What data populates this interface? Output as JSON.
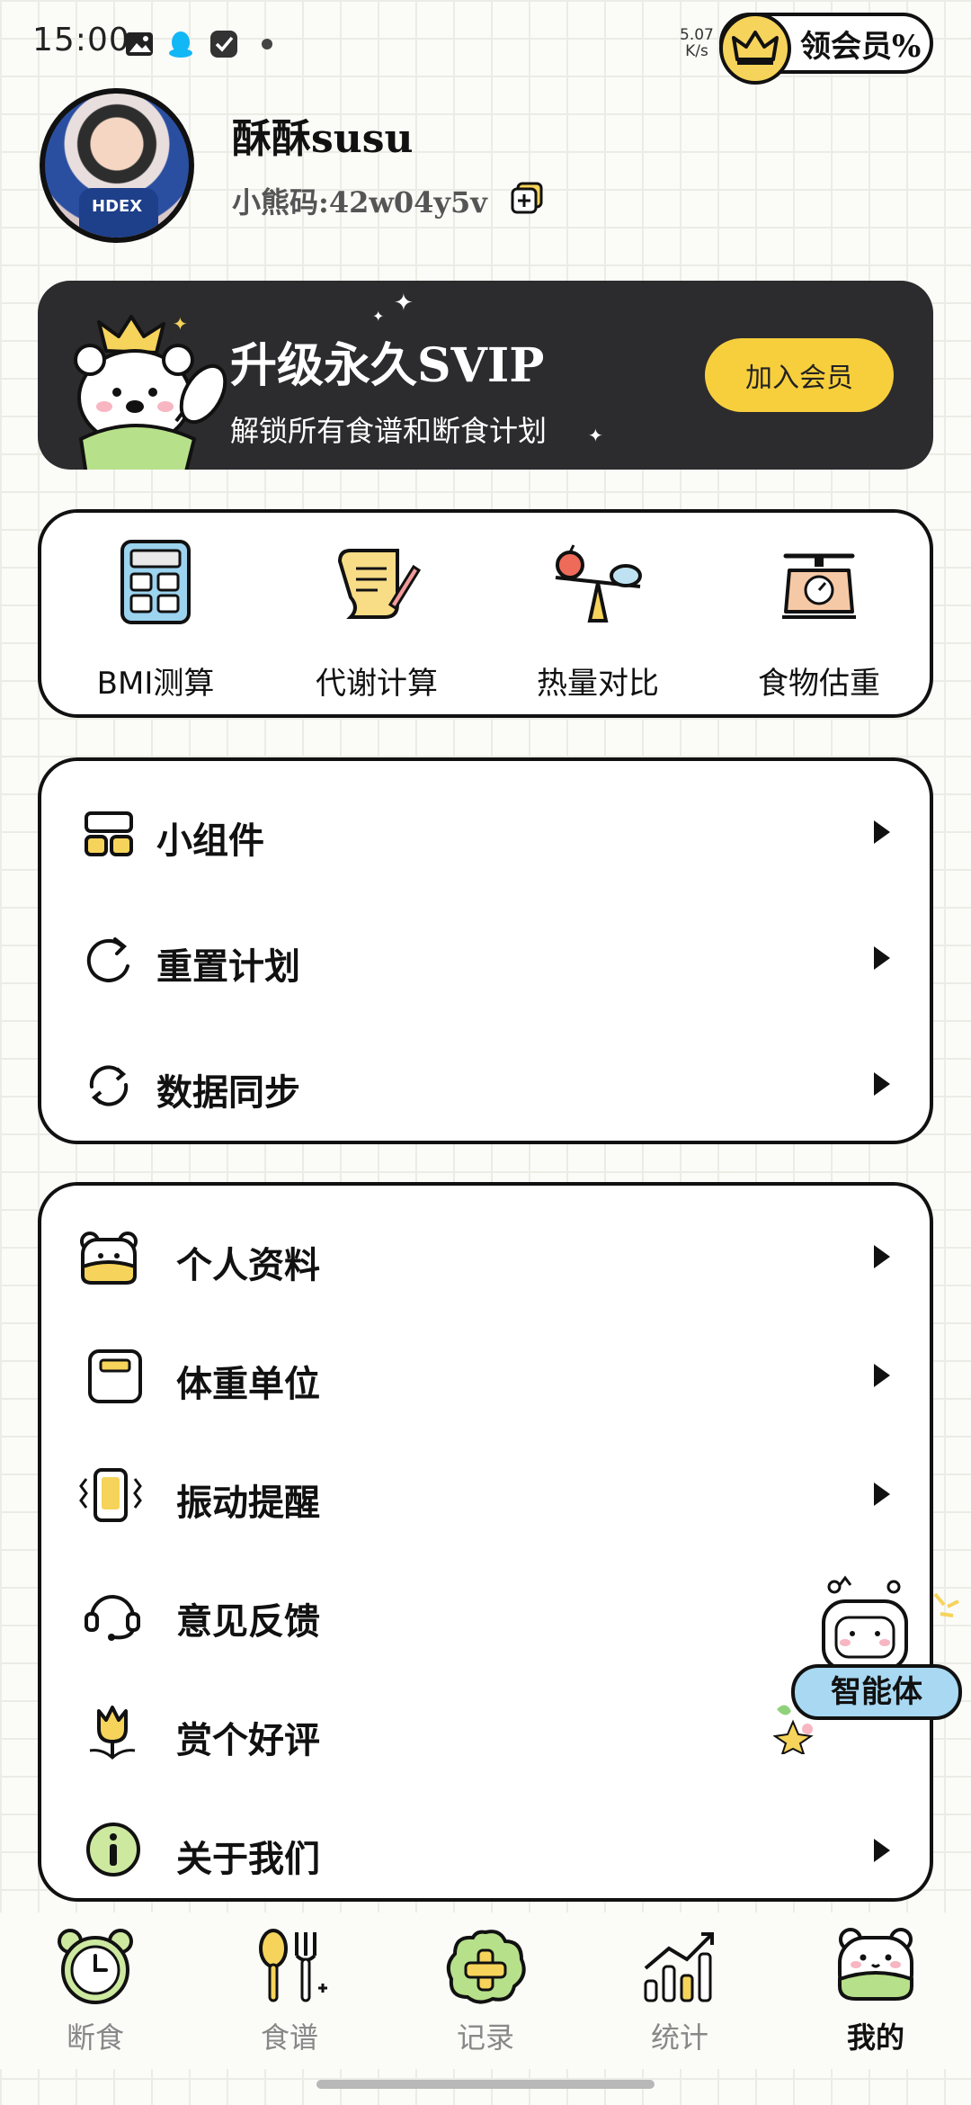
{
  "status_bar": {
    "time": "15:00",
    "net_speed_value": "5.07",
    "net_speed_unit": "K/s",
    "vip_badge_text": "领会员%"
  },
  "profile": {
    "username": "酥酥susu",
    "user_code": "小熊码:42w04y5v"
  },
  "banner": {
    "title": "升级永久SVIP",
    "subtitle": "解锁所有食谱和断食计划",
    "button_label": "加入会员"
  },
  "tools": [
    {
      "label": "BMI测算",
      "icon": "calculator-icon"
    },
    {
      "label": "代谢计算",
      "icon": "scroll-pen-icon"
    },
    {
      "label": "热量对比",
      "icon": "balance-scale-icon"
    },
    {
      "label": "食物估重",
      "icon": "kitchen-scale-icon"
    }
  ],
  "settings_group_1": [
    {
      "label": "小组件",
      "icon": "widget-grid-icon"
    },
    {
      "label": "重置计划",
      "icon": "reset-icon"
    },
    {
      "label": "数据同步",
      "icon": "sync-icon"
    }
  ],
  "settings_group_2": [
    {
      "label": "个人资料",
      "icon": "bear-profile-icon"
    },
    {
      "label": "体重单位",
      "icon": "scale-unit-icon"
    },
    {
      "label": "振动提醒",
      "icon": "vibration-icon"
    },
    {
      "label": "意见反馈",
      "icon": "headset-icon"
    },
    {
      "label": "赏个好评",
      "icon": "tulip-icon"
    },
    {
      "label": "关于我们",
      "icon": "info-icon"
    }
  ],
  "floating_agent": {
    "label": "智能体"
  },
  "tabbar": [
    {
      "label": "断食",
      "icon": "clock-icon",
      "active": false
    },
    {
      "label": "食谱",
      "icon": "spoon-fork-icon",
      "active": false
    },
    {
      "label": "记录",
      "icon": "add-record-icon",
      "active": false
    },
    {
      "label": "统计",
      "icon": "bar-chart-icon",
      "active": false
    },
    {
      "label": "我的",
      "icon": "bear-face-icon",
      "active": true
    }
  ],
  "colors": {
    "accent_yellow": "#f7cf3d",
    "banner_dark": "#2c2c2e",
    "agent_blue": "#a8d8f2",
    "text_dark": "#111111"
  }
}
